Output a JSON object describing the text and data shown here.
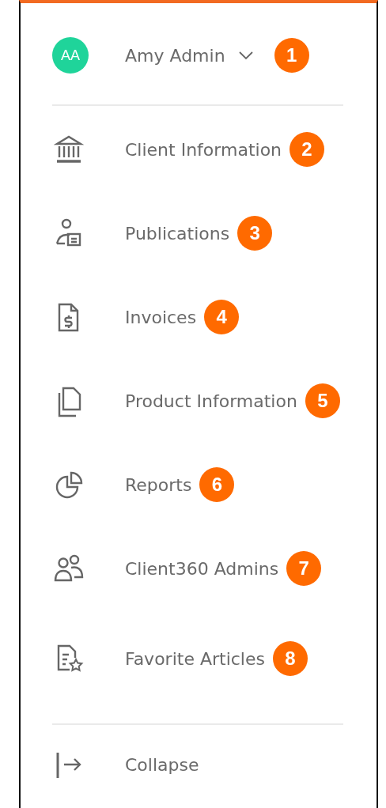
{
  "user": {
    "initials": "AA",
    "name": "Amy Admin",
    "badge": "1"
  },
  "nav_items": [
    {
      "kind": "bank",
      "label": "Client Information",
      "badge": "2"
    },
    {
      "kind": "contact",
      "label": "Publications",
      "badge": "3"
    },
    {
      "kind": "invoice",
      "label": "Invoices",
      "badge": "4"
    },
    {
      "kind": "pages",
      "label": "Product Information",
      "badge": "5"
    },
    {
      "kind": "pie",
      "label": "Reports",
      "badge": "6"
    },
    {
      "kind": "people",
      "label": "Client360 Admins",
      "badge": "7"
    },
    {
      "kind": "favorite",
      "label": "Favorite Articles",
      "badge": "8"
    }
  ],
  "collapse": {
    "label": "Collapse"
  }
}
